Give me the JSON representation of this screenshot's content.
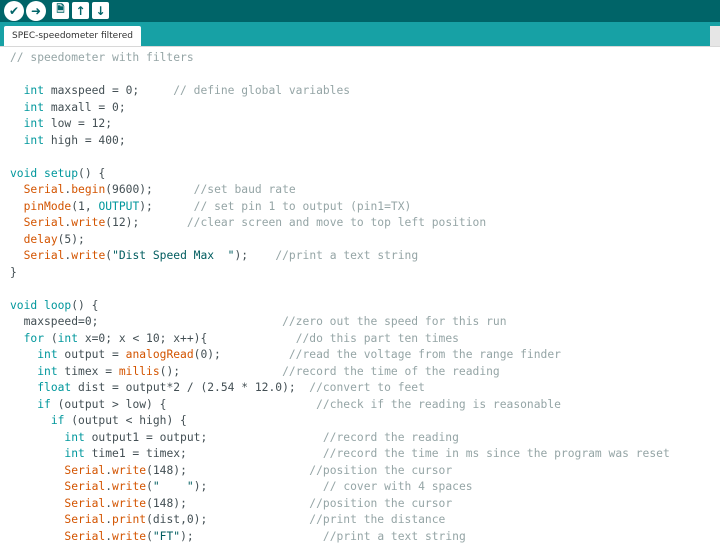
{
  "toolbar": {
    "verify_icon": "✔",
    "upload_icon": "➜",
    "new_icon": "🗎",
    "open_icon": "↑",
    "save_icon": "↓"
  },
  "tab": {
    "title": "SPEC-speedometer filtered"
  },
  "code": [
    [
      {
        "t": "// speedometer with filters",
        "c": "cm"
      }
    ],
    [],
    [
      {
        "t": "  "
      },
      {
        "t": "int",
        "c": "kw"
      },
      {
        "t": " maxspeed = 0;     "
      },
      {
        "t": "// define global variables",
        "c": "cm"
      }
    ],
    [
      {
        "t": "  "
      },
      {
        "t": "int",
        "c": "kw"
      },
      {
        "t": " maxall = 0;"
      }
    ],
    [
      {
        "t": "  "
      },
      {
        "t": "int",
        "c": "kw"
      },
      {
        "t": " low = 12;"
      }
    ],
    [
      {
        "t": "  "
      },
      {
        "t": "int",
        "c": "kw"
      },
      {
        "t": " high = 400;"
      }
    ],
    [],
    [
      {
        "t": "void",
        "c": "kw"
      },
      {
        "t": " "
      },
      {
        "t": "setup",
        "c": "kw"
      },
      {
        "t": "() {"
      }
    ],
    [
      {
        "t": "  "
      },
      {
        "t": "Serial",
        "c": "fn"
      },
      {
        "t": "."
      },
      {
        "t": "begin",
        "c": "fn"
      },
      {
        "t": "(9600);      "
      },
      {
        "t": "//set baud rate",
        "c": "cm"
      }
    ],
    [
      {
        "t": "  "
      },
      {
        "t": "pinMode",
        "c": "fn"
      },
      {
        "t": "(1, "
      },
      {
        "t": "OUTPUT",
        "c": "kw"
      },
      {
        "t": ");      "
      },
      {
        "t": "// set pin 1 to output (pin1=TX)",
        "c": "cm"
      }
    ],
    [
      {
        "t": "  "
      },
      {
        "t": "Serial",
        "c": "fn"
      },
      {
        "t": "."
      },
      {
        "t": "write",
        "c": "fn"
      },
      {
        "t": "(12);       "
      },
      {
        "t": "//clear screen and move to top left position",
        "c": "cm"
      }
    ],
    [
      {
        "t": "  "
      },
      {
        "t": "delay",
        "c": "fn"
      },
      {
        "t": "(5);"
      }
    ],
    [
      {
        "t": "  "
      },
      {
        "t": "Serial",
        "c": "fn"
      },
      {
        "t": "."
      },
      {
        "t": "write",
        "c": "fn"
      },
      {
        "t": "("
      },
      {
        "t": "\"Dist Speed Max  \"",
        "c": "st"
      },
      {
        "t": ");    "
      },
      {
        "t": "//print a text string",
        "c": "cm"
      }
    ],
    [
      {
        "t": "}"
      }
    ],
    [],
    [
      {
        "t": "void",
        "c": "kw"
      },
      {
        "t": " "
      },
      {
        "t": "loop",
        "c": "kw"
      },
      {
        "t": "() {"
      }
    ],
    [
      {
        "t": "  maxspeed=0;                           "
      },
      {
        "t": "//zero out the speed for this run",
        "c": "cm"
      }
    ],
    [
      {
        "t": "  "
      },
      {
        "t": "for",
        "c": "kw"
      },
      {
        "t": " ("
      },
      {
        "t": "int",
        "c": "kw"
      },
      {
        "t": " x=0; x < 10; x++){             "
      },
      {
        "t": "//do this part ten times",
        "c": "cm"
      }
    ],
    [
      {
        "t": "    "
      },
      {
        "t": "int",
        "c": "kw"
      },
      {
        "t": " output = "
      },
      {
        "t": "analogRead",
        "c": "fn"
      },
      {
        "t": "(0);          "
      },
      {
        "t": "//read the voltage from the range finder",
        "c": "cm"
      }
    ],
    [
      {
        "t": "    "
      },
      {
        "t": "int",
        "c": "kw"
      },
      {
        "t": " timex = "
      },
      {
        "t": "millis",
        "c": "fn"
      },
      {
        "t": "();               "
      },
      {
        "t": "//record the time of the reading",
        "c": "cm"
      }
    ],
    [
      {
        "t": "    "
      },
      {
        "t": "float",
        "c": "kw"
      },
      {
        "t": " dist = output*2 / (2.54 * 12.0);  "
      },
      {
        "t": "//convert to feet",
        "c": "cm"
      }
    ],
    [
      {
        "t": "    "
      },
      {
        "t": "if",
        "c": "kw"
      },
      {
        "t": " (output > low) {                      "
      },
      {
        "t": "//check if the reading is reasonable",
        "c": "cm"
      }
    ],
    [
      {
        "t": "      "
      },
      {
        "t": "if",
        "c": "kw"
      },
      {
        "t": " (output < high) {"
      }
    ],
    [
      {
        "t": "        "
      },
      {
        "t": "int",
        "c": "kw"
      },
      {
        "t": " output1 = output;                 "
      },
      {
        "t": "//record the reading",
        "c": "cm"
      }
    ],
    [
      {
        "t": "        "
      },
      {
        "t": "int",
        "c": "kw"
      },
      {
        "t": " time1 = timex;                    "
      },
      {
        "t": "//record the time in ms since the program was reset",
        "c": "cm"
      }
    ],
    [
      {
        "t": "        "
      },
      {
        "t": "Serial",
        "c": "fn"
      },
      {
        "t": "."
      },
      {
        "t": "write",
        "c": "fn"
      },
      {
        "t": "(148);                  "
      },
      {
        "t": "//position the cursor",
        "c": "cm"
      }
    ],
    [
      {
        "t": "        "
      },
      {
        "t": "Serial",
        "c": "fn"
      },
      {
        "t": "."
      },
      {
        "t": "write",
        "c": "fn"
      },
      {
        "t": "("
      },
      {
        "t": "\"    \"",
        "c": "st"
      },
      {
        "t": ");                 "
      },
      {
        "t": "// cover with 4 spaces",
        "c": "cm"
      }
    ],
    [
      {
        "t": "        "
      },
      {
        "t": "Serial",
        "c": "fn"
      },
      {
        "t": "."
      },
      {
        "t": "write",
        "c": "fn"
      },
      {
        "t": "(148);                  "
      },
      {
        "t": "//position the cursor",
        "c": "cm"
      }
    ],
    [
      {
        "t": "        "
      },
      {
        "t": "Serial",
        "c": "fn"
      },
      {
        "t": "."
      },
      {
        "t": "print",
        "c": "fn"
      },
      {
        "t": "(dist,0);               "
      },
      {
        "t": "//print the distance",
        "c": "cm"
      }
    ],
    [
      {
        "t": "        "
      },
      {
        "t": "Serial",
        "c": "fn"
      },
      {
        "t": "."
      },
      {
        "t": "write",
        "c": "fn"
      },
      {
        "t": "("
      },
      {
        "t": "\"FT\"",
        "c": "st"
      },
      {
        "t": ");                   "
      },
      {
        "t": "//print a text string",
        "c": "cm"
      }
    ]
  ]
}
